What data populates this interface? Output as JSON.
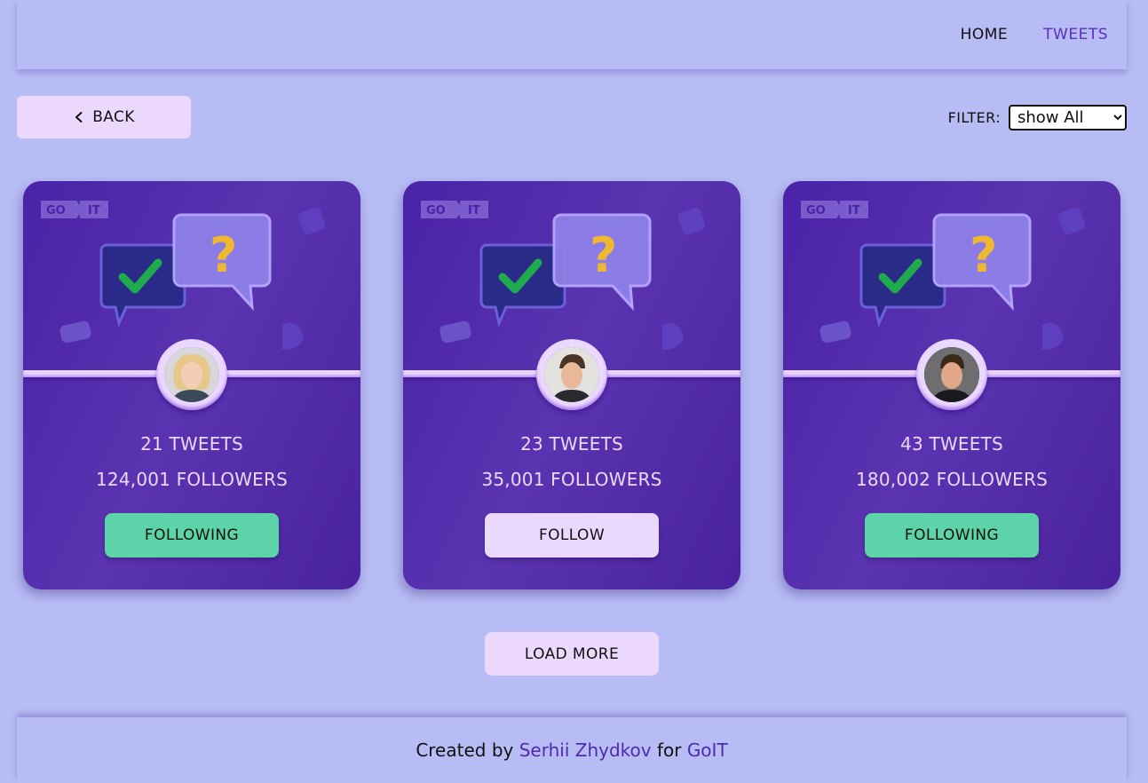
{
  "header": {
    "nav": [
      {
        "label": "HOME",
        "active": false
      },
      {
        "label": "TWEETS",
        "active": true
      }
    ]
  },
  "toolbar": {
    "back_label": "BACK",
    "filter_label": "FILTER:",
    "filter_value": "show All"
  },
  "brand": {
    "left": "GO",
    "right": "IT"
  },
  "cards": [
    {
      "tweets": "21 TWEETS",
      "followers": "124,001 FOLLOWERS",
      "button": "FOLLOWING",
      "following": true,
      "avatar": "woman-avatar"
    },
    {
      "tweets": "23 TWEETS",
      "followers": "35,001 FOLLOWERS",
      "button": "FOLLOW",
      "following": false,
      "avatar": "man-avatar"
    },
    {
      "tweets": "43 TWEETS",
      "followers": "180,002 FOLLOWERS",
      "button": "FOLLOWING",
      "following": true,
      "avatar": "man-avatar"
    }
  ],
  "load_more_label": "LOAD MORE",
  "footer": {
    "prefix": "Created by ",
    "author": "Serhii Zhydkov",
    "middle": " for ",
    "org": "GoIT"
  },
  "colors": {
    "page_bg": "#b8bcf5",
    "card_bg": "#4a22a8",
    "accent_purple": "#5b2fb8",
    "following_green": "#5cd3a8",
    "light_lilac": "#ebd8ff"
  }
}
